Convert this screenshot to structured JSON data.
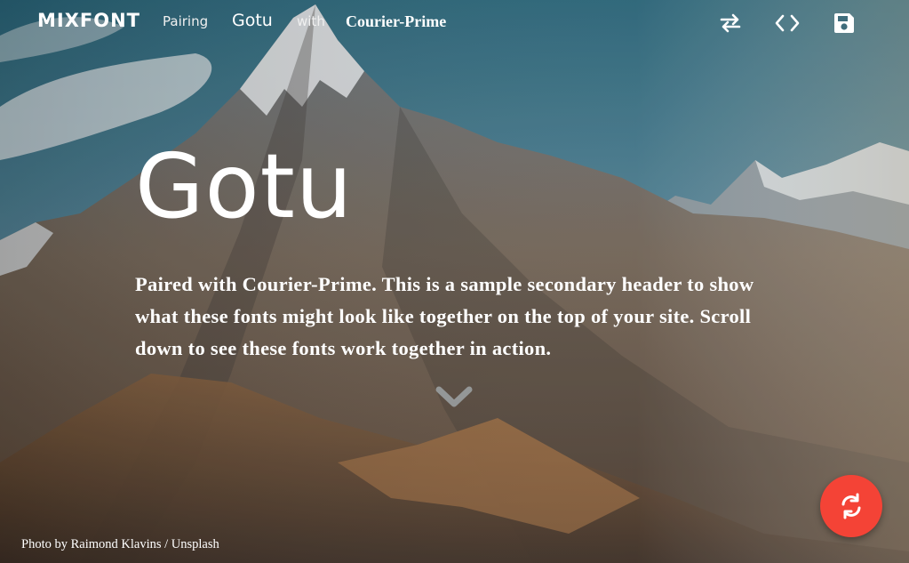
{
  "nav": {
    "logo": "MIXFONT",
    "pairing_label": "Pairing",
    "heading_font": "Gotu",
    "with_label": "with",
    "body_font": "Courier-Prime",
    "icons": {
      "swap": "swap-arrows-icon",
      "code": "code-icon",
      "save": "save-icon"
    }
  },
  "hero": {
    "title": "Gotu",
    "subtitle": "Paired with Courier-Prime. This is a sample secondary header to show what these fonts might look like together on the top of your site. Scroll down to see these fonts work together in action.",
    "scroll_icon": "chevron-down-icon"
  },
  "credit": "Photo by Raimond Klavins / Unsplash",
  "fab": {
    "icon": "refresh-icon",
    "color": "#f44336"
  }
}
